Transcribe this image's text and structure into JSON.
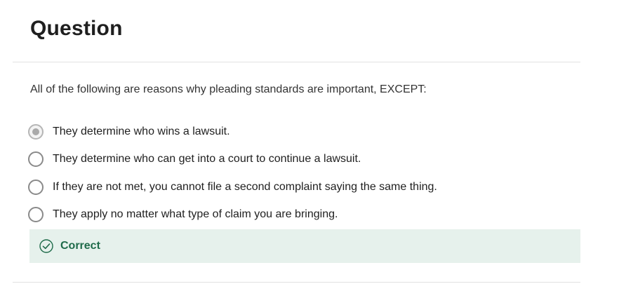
{
  "header": {
    "title": "Question"
  },
  "question": {
    "prompt": "All of the following are reasons why pleading standards are important, EXCEPT:",
    "options": [
      {
        "label": "They determine who wins a lawsuit.",
        "selected": true
      },
      {
        "label": "They determine who can get into a court to continue a lawsuit.",
        "selected": false
      },
      {
        "label": "If they are not met, you cannot file a second complaint saying the same thing.",
        "selected": false
      },
      {
        "label": "They apply no matter what type of claim you are bringing.",
        "selected": false
      }
    ]
  },
  "feedback": {
    "icon": "check-circle-icon",
    "text": "Correct",
    "color": "#1f6b4a",
    "background": "#e6f1ec"
  }
}
